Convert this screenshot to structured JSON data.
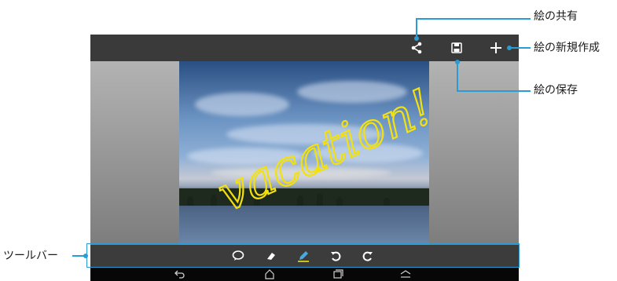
{
  "app_bar": {
    "share_icon": "share-icon",
    "save_icon": "save-icon",
    "add_icon": "plus-icon"
  },
  "canvas": {
    "handwriting_text": "vacation!",
    "ink_color": "#f3e10f"
  },
  "toolbar": {
    "tools": [
      {
        "name": "speech-bubble-icon"
      },
      {
        "name": "eraser-icon"
      },
      {
        "name": "pen-icon",
        "selected": true
      },
      {
        "name": "undo-icon"
      },
      {
        "name": "redo-icon"
      }
    ]
  },
  "navbar": {
    "buttons": [
      "back-icon",
      "home-icon",
      "recent-apps-icon",
      "menu-icon"
    ]
  },
  "callouts": {
    "share": "絵の共有",
    "new_drawing": "絵の新規作成",
    "save": "絵の保存",
    "toolbar": "ツールバー"
  },
  "colors": {
    "accent": "#2b9bd3",
    "bar": "#3a3a3a",
    "nav": "#070707"
  }
}
